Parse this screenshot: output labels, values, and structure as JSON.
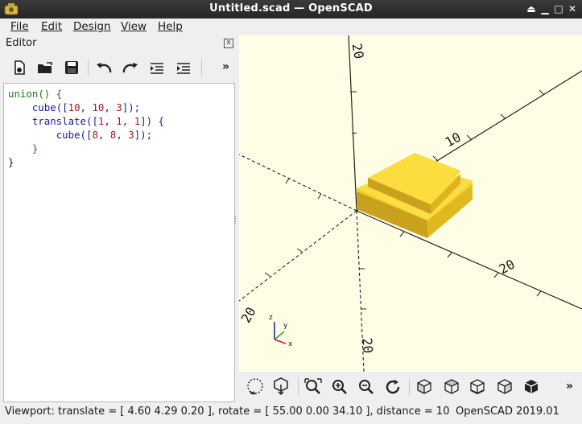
{
  "window": {
    "title": "Untitled.scad — OpenSCAD"
  },
  "menubar": {
    "items": [
      {
        "label": "File"
      },
      {
        "label": "Edit"
      },
      {
        "label": "Design"
      },
      {
        "label": "View"
      },
      {
        "label": "Help"
      }
    ]
  },
  "editor": {
    "header": "Editor",
    "close_glyph": "x",
    "toolbar_more": "»",
    "toolbar_icons": [
      "new-file-icon",
      "open-file-icon",
      "save-icon",
      "undo-icon",
      "redo-icon",
      "unindent-icon",
      "indent-icon"
    ],
    "code_lines": [
      [
        {
          "t": "union",
          "c": "kw"
        },
        {
          "t": "() {",
          "c": "kw"
        }
      ],
      [
        {
          "t": "    "
        },
        {
          "t": "cube",
          "c": "fn"
        },
        {
          "t": "([",
          "c": "fn"
        },
        {
          "t": "10",
          "c": "num"
        },
        {
          "t": ", ",
          "c": "fn"
        },
        {
          "t": "10",
          "c": "num"
        },
        {
          "t": ", ",
          "c": "fn"
        },
        {
          "t": "3",
          "c": "num"
        },
        {
          "t": "]);",
          "c": "fn"
        }
      ],
      [
        {
          "t": "    "
        },
        {
          "t": "translate",
          "c": "fn"
        },
        {
          "t": "([",
          "c": "fn"
        },
        {
          "t": "1",
          "c": "num"
        },
        {
          "t": ", ",
          "c": "fn"
        },
        {
          "t": "1",
          "c": "num"
        },
        {
          "t": ", ",
          "c": "fn"
        },
        {
          "t": "1",
          "c": "num"
        },
        {
          "t": "]) {",
          "c": "fn"
        }
      ],
      [
        {
          "t": "        "
        },
        {
          "t": "cube",
          "c": "fn"
        },
        {
          "t": "([",
          "c": "fn"
        },
        {
          "t": "8",
          "c": "num"
        },
        {
          "t": ", ",
          "c": "fn"
        },
        {
          "t": "8",
          "c": "num"
        },
        {
          "t": ", ",
          "c": "fn"
        },
        {
          "t": "3",
          "c": "num"
        },
        {
          "t": "]);",
          "c": "fn"
        }
      ],
      [
        {
          "t": "    }",
          "c": "kw"
        }
      ],
      [
        {
          "t": "}"
        }
      ]
    ]
  },
  "viewport": {
    "axis_labels": [
      {
        "text": "20",
        "name": "axis-label-z-20"
      },
      {
        "text": "10",
        "name": "axis-label-y-10"
      },
      {
        "text": "20",
        "name": "axis-label-x-20"
      },
      {
        "text": "20",
        "name": "axis-label-x-neg-20"
      },
      {
        "text": "20",
        "name": "axis-label-z-neg-20"
      }
    ],
    "axis_gizmo": {
      "x": "x",
      "y": "y",
      "z": "z"
    },
    "model_color": "#f9d72c"
  },
  "view_toolbar": {
    "more": "»",
    "icons": [
      "preview-icon",
      "render-icon",
      "view-all-icon",
      "zoom-in-icon",
      "zoom-out-icon",
      "reset-view-icon",
      "view-right-icon",
      "view-top-icon",
      "view-bottom-icon",
      "view-left-icon",
      "view-front-icon"
    ]
  },
  "status": {
    "viewport_text": "Viewport: translate = [ 4.60 4.29 0.20 ], rotate = [ 55.00 0.00 34.10 ], distance = 10",
    "version_text": "OpenSCAD 2019.01"
  },
  "colors": {
    "titlebar": "#2b2b2b",
    "viewport_bg": "#fffde6",
    "keyword": "#1a7a1a",
    "function": "#1a1aa0",
    "number": "#a01a1a"
  }
}
